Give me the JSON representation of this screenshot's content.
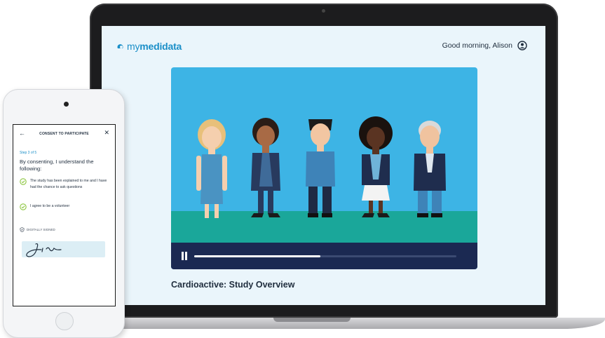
{
  "laptop": {
    "app": {
      "logo_my": "my",
      "logo_medidata": "medidata"
    },
    "header": {
      "greeting": "Good morning, Alison",
      "user_icon": "user-circle-icon"
    },
    "video": {
      "title": "Cardioactive: Study Overview",
      "progress": 0.48,
      "state_icon": "pause-icon",
      "colors": {
        "sky": "#3db4e5",
        "ground": "#1aa79a",
        "controls": "#1b2952"
      }
    }
  },
  "phone": {
    "header": {
      "title": "CONSENT TO PARTICIPATE",
      "back": "←",
      "close": "✕"
    },
    "step": "Step 3 of 5",
    "heading": "By consenting, I understand the following:",
    "items": [
      {
        "text": "The study has been explained to me and I have had the chance to ask questions",
        "checked": true
      },
      {
        "text": "I agree to be a volunteer",
        "checked": true
      }
    ],
    "signed_label": "DIGITALLY SIGNED",
    "accent": "#1b8fc8",
    "check_color": "#8cc63f"
  }
}
